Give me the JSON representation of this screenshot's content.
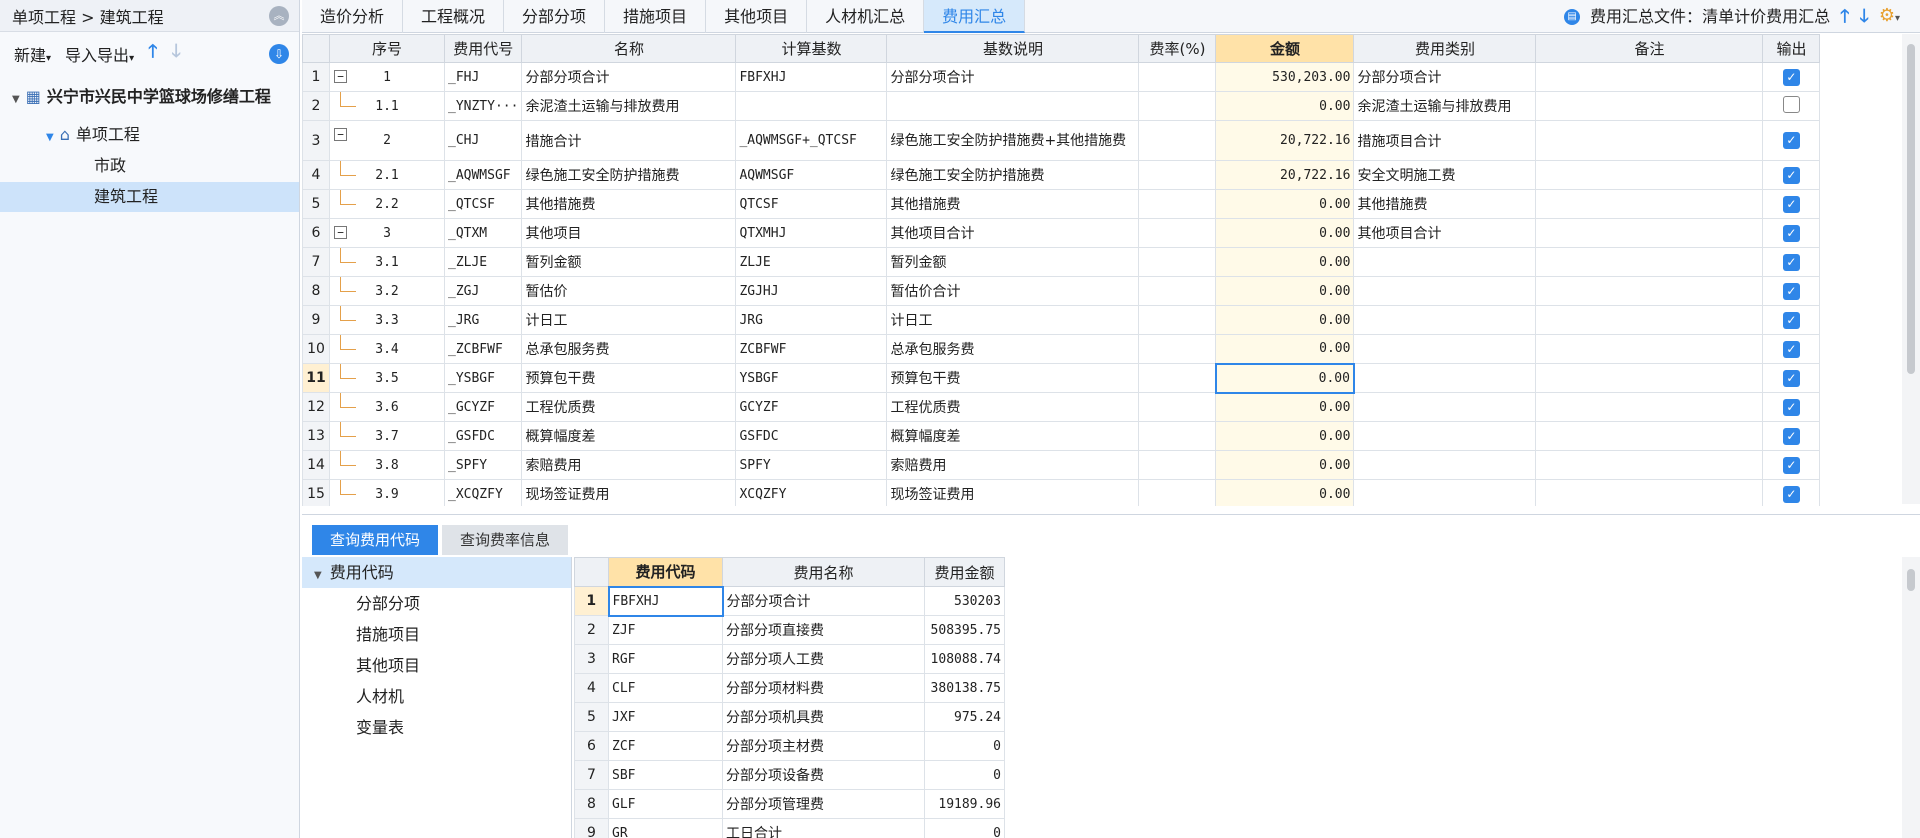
{
  "breadcrumb": {
    "path": "单项工程 > 建筑工程"
  },
  "left_toolbar": {
    "new_label": "新建",
    "import_export_label": "导入导出"
  },
  "project_tree": [
    {
      "label": "兴宁市兴民中学篮球场修缮工程",
      "icon": "building-icon"
    },
    {
      "label": "单项工程",
      "icon": "house-icon"
    },
    {
      "label": "市政"
    },
    {
      "label": "建筑工程"
    }
  ],
  "tabs": [
    "造价分析",
    "工程概况",
    "分部分项",
    "措施项目",
    "其他项目",
    "人材机汇总",
    "费用汇总"
  ],
  "active_tab": "费用汇总",
  "summary_file": {
    "label": "费用汇总文件：",
    "value": "清单计价费用汇总"
  },
  "main_table": {
    "columns": [
      "序号",
      "费用代号",
      "名称",
      "计算基数",
      "基数说明",
      "费率(%)",
      "金额",
      "费用类别",
      "备注",
      "输出"
    ],
    "rows": [
      {
        "n": "1",
        "seq": "1",
        "code": "_FHJ",
        "name": "分部分项合计",
        "base": "FBFXHJ",
        "desc": "分部分项合计",
        "rate": "",
        "amount": "530,203.00",
        "cat": "分部分项合计",
        "note": "",
        "out": true
      },
      {
        "n": "2",
        "seq": "1.1",
        "code": "_YNZTY···",
        "name": "余泥渣土运输与排放费用",
        "base": "",
        "desc": "",
        "rate": "",
        "amount": "0.00",
        "cat": "余泥渣土运输与排放费用",
        "note": "",
        "out": false
      },
      {
        "n": "3",
        "seq": "2",
        "code": "_CHJ",
        "name": "措施合计",
        "base": "_AQWMSGF+_QTCSF",
        "desc": "绿色施工安全防护措施费+其他措施费",
        "rate": "",
        "amount": "20,722.16",
        "cat": "措施项目合计",
        "note": "",
        "out": true
      },
      {
        "n": "4",
        "seq": "2.1",
        "code": "_AQWMSGF",
        "name": "绿色施工安全防护措施费",
        "base": "AQWMSGF",
        "desc": "绿色施工安全防护措施费",
        "rate": "",
        "amount": "20,722.16",
        "cat": "安全文明施工费",
        "note": "",
        "out": true
      },
      {
        "n": "5",
        "seq": "2.2",
        "code": "_QTCSF",
        "name": "其他措施费",
        "base": "QTCSF",
        "desc": "其他措施费",
        "rate": "",
        "amount": "0.00",
        "cat": "其他措施费",
        "note": "",
        "out": true
      },
      {
        "n": "6",
        "seq": "3",
        "code": "_QTXM",
        "name": "其他项目",
        "base": "QTXMHJ",
        "desc": "其他项目合计",
        "rate": "",
        "amount": "0.00",
        "cat": "其他项目合计",
        "note": "",
        "out": true
      },
      {
        "n": "7",
        "seq": "3.1",
        "code": "_ZLJE",
        "name": "暂列金额",
        "base": "ZLJE",
        "desc": "暂列金额",
        "rate": "",
        "amount": "0.00",
        "cat": "",
        "note": "",
        "out": true
      },
      {
        "n": "8",
        "seq": "3.2",
        "code": "_ZGJ",
        "name": "暂估价",
        "base": "ZGJHJ",
        "desc": "暂估价合计",
        "rate": "",
        "amount": "0.00",
        "cat": "",
        "note": "",
        "out": true
      },
      {
        "n": "9",
        "seq": "3.3",
        "code": "_JRG",
        "name": "计日工",
        "base": "JRG",
        "desc": "计日工",
        "rate": "",
        "amount": "0.00",
        "cat": "",
        "note": "",
        "out": true
      },
      {
        "n": "10",
        "seq": "3.4",
        "code": "_ZCBFWF",
        "name": "总承包服务费",
        "base": "ZCBFWF",
        "desc": "总承包服务费",
        "rate": "",
        "amount": "0.00",
        "cat": "",
        "note": "",
        "out": true
      },
      {
        "n": "11",
        "seq": "3.5",
        "code": "_YSBGF",
        "name": "预算包干费",
        "base": "YSBGF",
        "desc": "预算包干费",
        "rate": "",
        "amount": "0.00",
        "cat": "",
        "note": "",
        "out": true
      },
      {
        "n": "12",
        "seq": "3.6",
        "code": "_GCYZF",
        "name": "工程优质费",
        "base": "GCYZF",
        "desc": "工程优质费",
        "rate": "",
        "amount": "0.00",
        "cat": "",
        "note": "",
        "out": true
      },
      {
        "n": "13",
        "seq": "3.7",
        "code": "_GSFDC",
        "name": "概算幅度差",
        "base": "GSFDC",
        "desc": "概算幅度差",
        "rate": "",
        "amount": "0.00",
        "cat": "",
        "note": "",
        "out": true
      },
      {
        "n": "14",
        "seq": "3.8",
        "code": "_SPFY",
        "name": "索赔费用",
        "base": "SPFY",
        "desc": "索赔费用",
        "rate": "",
        "amount": "0.00",
        "cat": "",
        "note": "",
        "out": true
      },
      {
        "n": "15",
        "seq": "3.9",
        "code": "_XCQZFY",
        "name": "现场签证费用",
        "base": "XCQZFY",
        "desc": "现场签证费用",
        "rate": "",
        "amount": "0.00",
        "cat": "",
        "note": "",
        "out": true
      }
    ]
  },
  "bottom_tabs": [
    "查询费用代码",
    "查询费率信息"
  ],
  "code_tree": {
    "root": "费用代码",
    "items": [
      "分部分项",
      "措施项目",
      "其他项目",
      "人材机",
      "变量表"
    ]
  },
  "code_table": {
    "columns": [
      "费用代码",
      "费用名称",
      "费用金额"
    ],
    "rows": [
      {
        "n": "1",
        "code": "FBFXHJ",
        "name": "分部分项合计",
        "amount": "530203"
      },
      {
        "n": "2",
        "code": "ZJF",
        "name": "分部分项直接费",
        "amount": "508395.75"
      },
      {
        "n": "3",
        "code": "RGF",
        "name": "分部分项人工费",
        "amount": "108088.74"
      },
      {
        "n": "4",
        "code": "CLF",
        "name": "分部分项材料费",
        "amount": "380138.75"
      },
      {
        "n": "5",
        "code": "JXF",
        "name": "分部分项机具费",
        "amount": "975.24"
      },
      {
        "n": "6",
        "code": "ZCF",
        "name": "分部分项主材费",
        "amount": "0"
      },
      {
        "n": "7",
        "code": "SBF",
        "name": "分部分项设备费",
        "amount": "0"
      },
      {
        "n": "8",
        "code": "GLF",
        "name": "分部分项管理费",
        "amount": "19189.96"
      },
      {
        "n": "9",
        "code": "GR",
        "name": "工日合计",
        "amount": "0"
      }
    ]
  }
}
